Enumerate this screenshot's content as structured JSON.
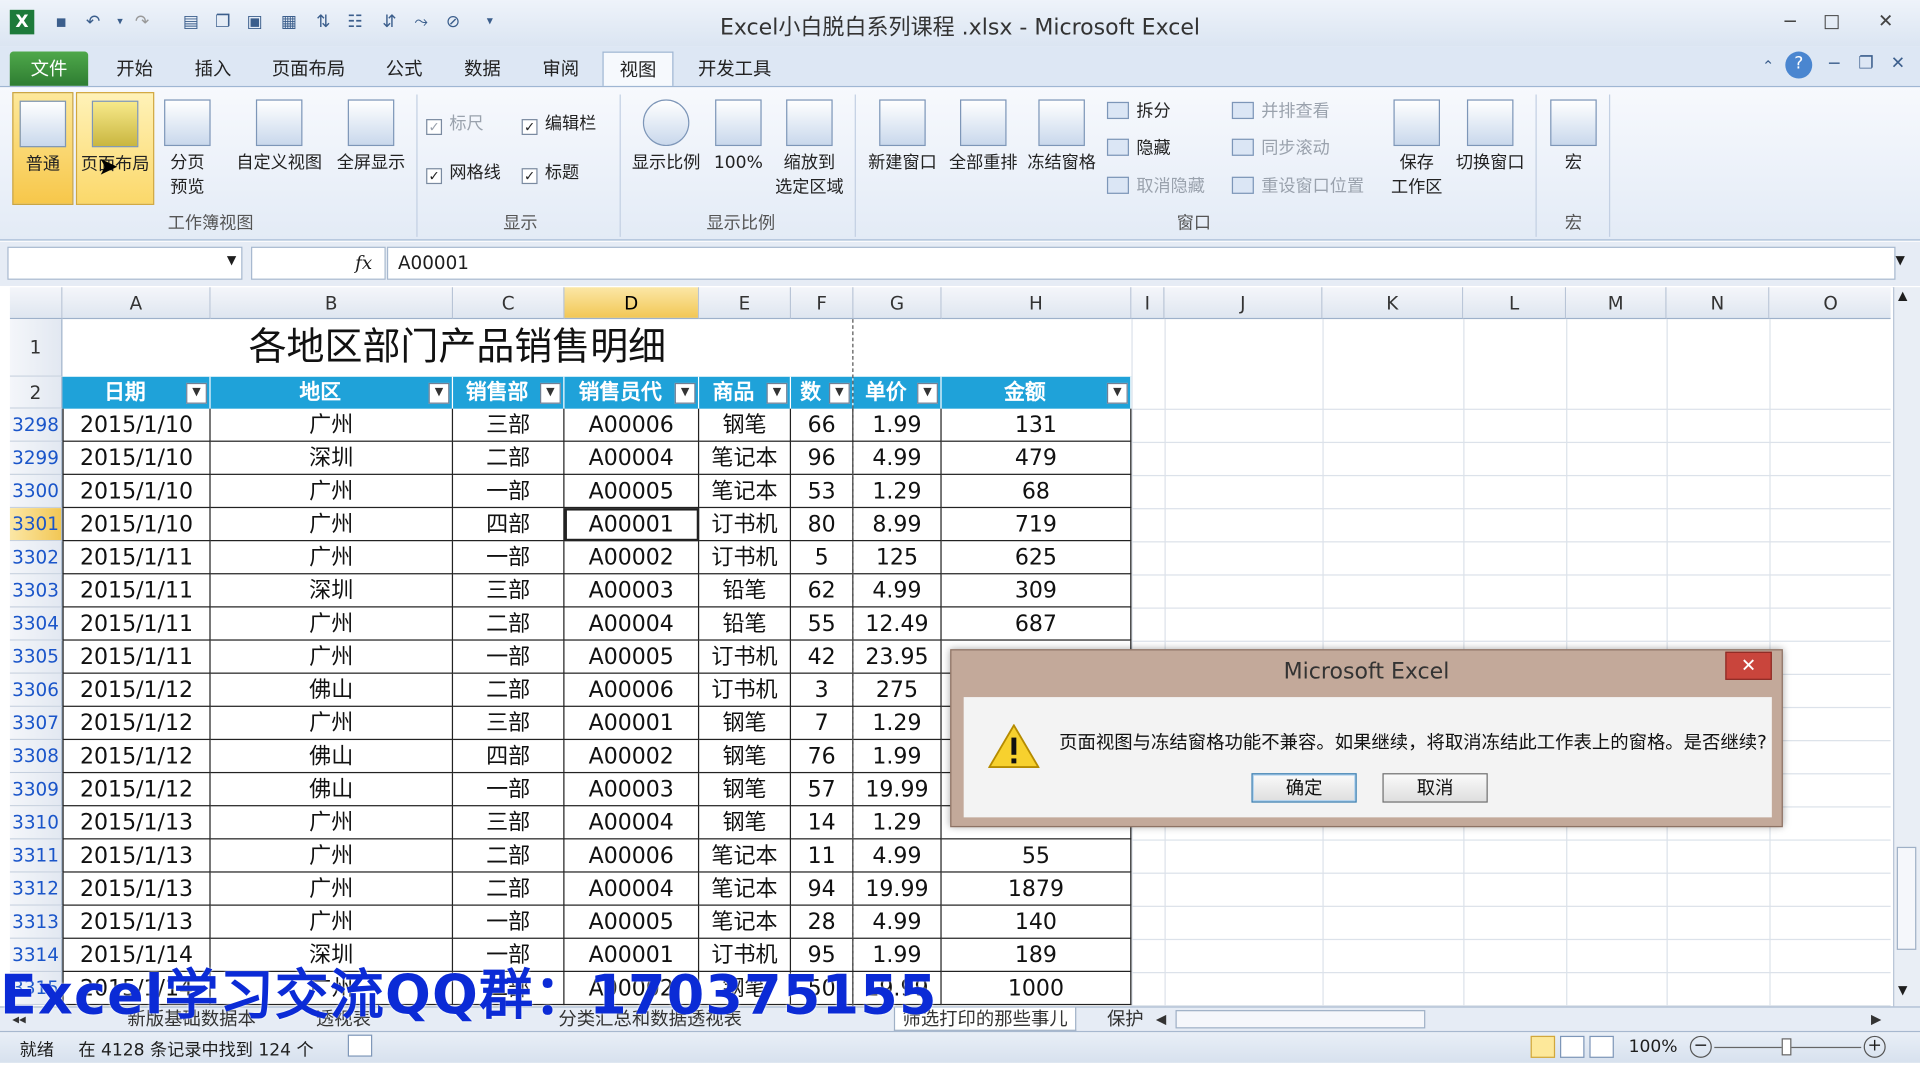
{
  "window": {
    "title": "Excel小白脱白系列课程 .xlsx - Microsoft Excel"
  },
  "tabs": [
    "文件",
    "开始",
    "插入",
    "页面布局",
    "公式",
    "数据",
    "审阅",
    "视图",
    "开发工具"
  ],
  "ribbon": {
    "workbook_views": {
      "normal": "普通",
      "page_layout": "页面布局",
      "page_break_1": "分页",
      "page_break_2": "预览",
      "custom_views": "自定义视图",
      "full_screen": "全屏显示",
      "group_label": "工作簿视图"
    },
    "show": {
      "ruler": "标尺",
      "formula_bar": "编辑栏",
      "gridlines": "网格线",
      "headings": "标题",
      "group_label": "显示"
    },
    "zoom": {
      "zoom": "显示比例",
      "hundred": "100%",
      "zoom_sel_1": "缩放到",
      "zoom_sel_2": "选定区域",
      "group_label": "显示比例"
    },
    "window": {
      "new_window": "新建窗口",
      "arrange_all": "全部重排",
      "freeze_panes": "冻结窗格",
      "split": "拆分",
      "hide": "隐藏",
      "unhide": "取消隐藏",
      "side_by_side": "并排查看",
      "sync_scroll": "同步滚动",
      "reset_pos": "重设窗口位置",
      "save_ws_1": "保存",
      "save_ws_2": "工作区",
      "switch_windows": "切换窗口",
      "group_label": "窗口"
    },
    "macros": {
      "macros": "宏",
      "group_label": "宏"
    }
  },
  "formula_bar": {
    "name_box": "",
    "fx": "fx",
    "value": "A00001"
  },
  "columns": [
    "A",
    "B",
    "C",
    "D",
    "E",
    "F",
    "G",
    "H",
    "I",
    "J",
    "K",
    "L",
    "M",
    "N",
    "O"
  ],
  "sheet": {
    "title": "各地区部门产品销售明细",
    "headers": [
      "日期",
      "地区",
      "销售部",
      "销售员代",
      "商品",
      "数",
      "单价",
      "金额"
    ],
    "rows": [
      {
        "n": "3298",
        "c": [
          "2015/1/10",
          "广州",
          "三部",
          "A00006",
          "钢笔",
          "66",
          "1.99",
          "131"
        ]
      },
      {
        "n": "3299",
        "c": [
          "2015/1/10",
          "深圳",
          "二部",
          "A00004",
          "笔记本",
          "96",
          "4.99",
          "479"
        ]
      },
      {
        "n": "3300",
        "c": [
          "2015/1/10",
          "广州",
          "一部",
          "A00005",
          "笔记本",
          "53",
          "1.29",
          "68"
        ]
      },
      {
        "n": "3301",
        "c": [
          "2015/1/10",
          "广州",
          "四部",
          "A00001",
          "订书机",
          "80",
          "8.99",
          "719"
        ]
      },
      {
        "n": "3302",
        "c": [
          "2015/1/11",
          "广州",
          "一部",
          "A00002",
          "订书机",
          "5",
          "125",
          "625"
        ]
      },
      {
        "n": "3303",
        "c": [
          "2015/1/11",
          "深圳",
          "三部",
          "A00003",
          "铅笔",
          "62",
          "4.99",
          "309"
        ]
      },
      {
        "n": "3304",
        "c": [
          "2015/1/11",
          "广州",
          "二部",
          "A00004",
          "铅笔",
          "55",
          "12.49",
          "687"
        ]
      },
      {
        "n": "3305",
        "c": [
          "2015/1/11",
          "广州",
          "一部",
          "A00005",
          "订书机",
          "42",
          "23.95",
          ""
        ]
      },
      {
        "n": "3306",
        "c": [
          "2015/1/12",
          "佛山",
          "二部",
          "A00006",
          "订书机",
          "3",
          "275",
          ""
        ]
      },
      {
        "n": "3307",
        "c": [
          "2015/1/12",
          "广州",
          "三部",
          "A00001",
          "钢笔",
          "7",
          "1.29",
          ""
        ]
      },
      {
        "n": "3308",
        "c": [
          "2015/1/12",
          "佛山",
          "四部",
          "A00002",
          "钢笔",
          "76",
          "1.99",
          ""
        ]
      },
      {
        "n": "3309",
        "c": [
          "2015/1/12",
          "佛山",
          "一部",
          "A00003",
          "钢笔",
          "57",
          "19.99",
          ""
        ]
      },
      {
        "n": "3310",
        "c": [
          "2015/1/13",
          "广州",
          "三部",
          "A00004",
          "钢笔",
          "14",
          "1.29",
          ""
        ]
      },
      {
        "n": "3311",
        "c": [
          "2015/1/13",
          "广州",
          "二部",
          "A00006",
          "笔记本",
          "11",
          "4.99",
          "55"
        ]
      },
      {
        "n": "3312",
        "c": [
          "2015/1/13",
          "广州",
          "二部",
          "A00004",
          "笔记本",
          "94",
          "19.99",
          "1879"
        ]
      },
      {
        "n": "3313",
        "c": [
          "2015/1/13",
          "广州",
          "一部",
          "A00005",
          "笔记本",
          "28",
          "4.99",
          "140"
        ]
      },
      {
        "n": "3314",
        "c": [
          "2015/1/14",
          "深圳",
          "一部",
          "A00001",
          "订书机",
          "95",
          "1.99",
          "189"
        ]
      },
      {
        "n": "3315",
        "c": [
          "2015/1/14",
          "广州",
          "二部",
          "A00002",
          "钢笔",
          "50",
          "19.99",
          "1000"
        ]
      }
    ]
  },
  "sheet_tabs": [
    "新版基础数据本",
    "透视表",
    "分类汇总和数据透视表",
    "筛选打印的那些事儿",
    "保护"
  ],
  "status": {
    "ready": "就绪",
    "filter_info": "在 4128 条记录中找到 124 个",
    "zoom": "100%"
  },
  "watermark": "Excel学习交流QQ群：170375155",
  "dialog": {
    "title": "Microsoft Excel",
    "close": "✕",
    "message": "页面视图与冻结窗格功能不兼容。如果继续，将取消冻结此工作表上的窗格。是否继续?",
    "ok": "确定",
    "cancel": "取消"
  }
}
